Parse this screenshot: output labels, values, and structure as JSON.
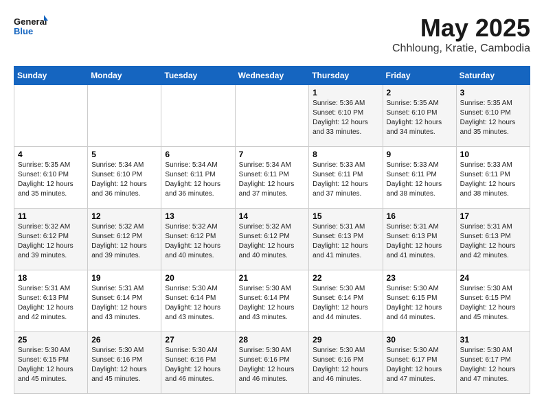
{
  "logo": {
    "line1": "General",
    "line2": "Blue"
  },
  "title": "May 2025",
  "subtitle": "Chhloung, Kratie, Cambodia",
  "days_of_week": [
    "Sunday",
    "Monday",
    "Tuesday",
    "Wednesday",
    "Thursday",
    "Friday",
    "Saturday"
  ],
  "weeks": [
    [
      {
        "day": "",
        "info": ""
      },
      {
        "day": "",
        "info": ""
      },
      {
        "day": "",
        "info": ""
      },
      {
        "day": "",
        "info": ""
      },
      {
        "day": "1",
        "info": "Sunrise: 5:36 AM\nSunset: 6:10 PM\nDaylight: 12 hours\nand 33 minutes."
      },
      {
        "day": "2",
        "info": "Sunrise: 5:35 AM\nSunset: 6:10 PM\nDaylight: 12 hours\nand 34 minutes."
      },
      {
        "day": "3",
        "info": "Sunrise: 5:35 AM\nSunset: 6:10 PM\nDaylight: 12 hours\nand 35 minutes."
      }
    ],
    [
      {
        "day": "4",
        "info": "Sunrise: 5:35 AM\nSunset: 6:10 PM\nDaylight: 12 hours\nand 35 minutes."
      },
      {
        "day": "5",
        "info": "Sunrise: 5:34 AM\nSunset: 6:10 PM\nDaylight: 12 hours\nand 36 minutes."
      },
      {
        "day": "6",
        "info": "Sunrise: 5:34 AM\nSunset: 6:11 PM\nDaylight: 12 hours\nand 36 minutes."
      },
      {
        "day": "7",
        "info": "Sunrise: 5:34 AM\nSunset: 6:11 PM\nDaylight: 12 hours\nand 37 minutes."
      },
      {
        "day": "8",
        "info": "Sunrise: 5:33 AM\nSunset: 6:11 PM\nDaylight: 12 hours\nand 37 minutes."
      },
      {
        "day": "9",
        "info": "Sunrise: 5:33 AM\nSunset: 6:11 PM\nDaylight: 12 hours\nand 38 minutes."
      },
      {
        "day": "10",
        "info": "Sunrise: 5:33 AM\nSunset: 6:11 PM\nDaylight: 12 hours\nand 38 minutes."
      }
    ],
    [
      {
        "day": "11",
        "info": "Sunrise: 5:32 AM\nSunset: 6:12 PM\nDaylight: 12 hours\nand 39 minutes."
      },
      {
        "day": "12",
        "info": "Sunrise: 5:32 AM\nSunset: 6:12 PM\nDaylight: 12 hours\nand 39 minutes."
      },
      {
        "day": "13",
        "info": "Sunrise: 5:32 AM\nSunset: 6:12 PM\nDaylight: 12 hours\nand 40 minutes."
      },
      {
        "day": "14",
        "info": "Sunrise: 5:32 AM\nSunset: 6:12 PM\nDaylight: 12 hours\nand 40 minutes."
      },
      {
        "day": "15",
        "info": "Sunrise: 5:31 AM\nSunset: 6:13 PM\nDaylight: 12 hours\nand 41 minutes."
      },
      {
        "day": "16",
        "info": "Sunrise: 5:31 AM\nSunset: 6:13 PM\nDaylight: 12 hours\nand 41 minutes."
      },
      {
        "day": "17",
        "info": "Sunrise: 5:31 AM\nSunset: 6:13 PM\nDaylight: 12 hours\nand 42 minutes."
      }
    ],
    [
      {
        "day": "18",
        "info": "Sunrise: 5:31 AM\nSunset: 6:13 PM\nDaylight: 12 hours\nand 42 minutes."
      },
      {
        "day": "19",
        "info": "Sunrise: 5:31 AM\nSunset: 6:14 PM\nDaylight: 12 hours\nand 43 minutes."
      },
      {
        "day": "20",
        "info": "Sunrise: 5:30 AM\nSunset: 6:14 PM\nDaylight: 12 hours\nand 43 minutes."
      },
      {
        "day": "21",
        "info": "Sunrise: 5:30 AM\nSunset: 6:14 PM\nDaylight: 12 hours\nand 43 minutes."
      },
      {
        "day": "22",
        "info": "Sunrise: 5:30 AM\nSunset: 6:14 PM\nDaylight: 12 hours\nand 44 minutes."
      },
      {
        "day": "23",
        "info": "Sunrise: 5:30 AM\nSunset: 6:15 PM\nDaylight: 12 hours\nand 44 minutes."
      },
      {
        "day": "24",
        "info": "Sunrise: 5:30 AM\nSunset: 6:15 PM\nDaylight: 12 hours\nand 45 minutes."
      }
    ],
    [
      {
        "day": "25",
        "info": "Sunrise: 5:30 AM\nSunset: 6:15 PM\nDaylight: 12 hours\nand 45 minutes."
      },
      {
        "day": "26",
        "info": "Sunrise: 5:30 AM\nSunset: 6:16 PM\nDaylight: 12 hours\nand 45 minutes."
      },
      {
        "day": "27",
        "info": "Sunrise: 5:30 AM\nSunset: 6:16 PM\nDaylight: 12 hours\nand 46 minutes."
      },
      {
        "day": "28",
        "info": "Sunrise: 5:30 AM\nSunset: 6:16 PM\nDaylight: 12 hours\nand 46 minutes."
      },
      {
        "day": "29",
        "info": "Sunrise: 5:30 AM\nSunset: 6:16 PM\nDaylight: 12 hours\nand 46 minutes."
      },
      {
        "day": "30",
        "info": "Sunrise: 5:30 AM\nSunset: 6:17 PM\nDaylight: 12 hours\nand 47 minutes."
      },
      {
        "day": "31",
        "info": "Sunrise: 5:30 AM\nSunset: 6:17 PM\nDaylight: 12 hours\nand 47 minutes."
      }
    ]
  ]
}
